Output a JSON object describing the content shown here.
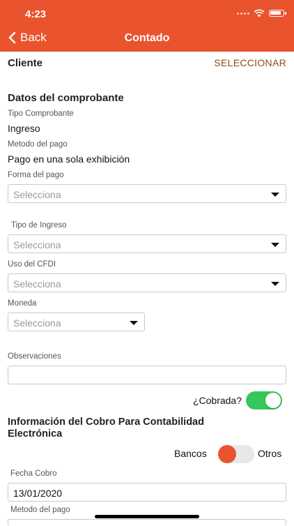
{
  "status_bar": {
    "time": "4:23"
  },
  "nav": {
    "back_label": "Back",
    "title": "Contado"
  },
  "cliente": {
    "label": "Cliente",
    "action": "SELECCIONAR"
  },
  "comprobante": {
    "section_title": "Datos del comprobante",
    "tipo_label": "Tipo Comprobante",
    "tipo_value": "Ingreso",
    "metodo_label": "Metodo del pago",
    "metodo_value": "Pago en una sola exhibición"
  },
  "forma_pago": {
    "label": "Forma del pago",
    "placeholder": "Selecciona"
  },
  "tipo_ingreso": {
    "label": "Tipo de Ingreso",
    "placeholder": "Selecciona"
  },
  "uso_cfdi": {
    "label": "Uso del CFDI",
    "placeholder": "Selecciona"
  },
  "moneda": {
    "label": "Moneda",
    "placeholder": "Selecciona"
  },
  "observaciones": {
    "label": "Observaciones",
    "value": ""
  },
  "cobrada": {
    "label": "¿Cobrada?",
    "checked": true
  },
  "contabilidad": {
    "title": "Información del Cobro Para Contabilidad Electrónica",
    "bancos_label": "Bancos",
    "otros_label": "Otros",
    "fecha_label": "Fecha Cobro",
    "fecha_value": "13/01/2020",
    "metodo_label": "Metodo del pago"
  },
  "colors": {
    "accent": "#e9532e",
    "switch_on": "#34c759",
    "link": "#8b4a1b"
  }
}
